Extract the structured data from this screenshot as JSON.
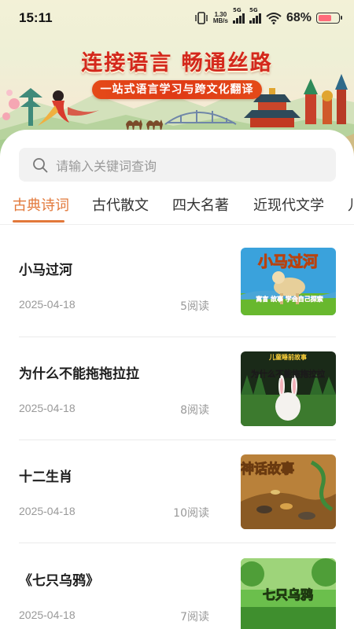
{
  "status_bar": {
    "time": "15:11",
    "net_speed_value": "1.30",
    "net_speed_unit": "MB/s",
    "signal_1_tag": "5G",
    "signal_2_tag": "5G",
    "battery_text": "68%",
    "battery_level": 0.68
  },
  "banner": {
    "title": "连接语言 畅通丝路",
    "subtitle": "一站式语言学习与跨文化翻译"
  },
  "search": {
    "placeholder": "请输入关键词查询"
  },
  "tabs": [
    {
      "label": "古典诗词",
      "active": true
    },
    {
      "label": "古代散文",
      "active": false
    },
    {
      "label": "四大名著",
      "active": false
    },
    {
      "label": "近现代文学",
      "active": false
    },
    {
      "label": "儿",
      "active": false
    }
  ],
  "articles": [
    {
      "title": "小马过河",
      "date": "2025-04-18",
      "reads": "5阅读",
      "thumb": {
        "headline": "小马过河",
        "caption": "寓言 故事  学会自己探索",
        "bg": "#3aa2dc",
        "ground": "#68b82e"
      }
    },
    {
      "title": "为什么不能拖拖拉拉",
      "date": "2025-04-18",
      "reads": "8阅读",
      "thumb": {
        "headline": "为什么不能拖拖拉拉",
        "caption": "儿童睡前故事",
        "bg": "#1a2a18",
        "ground": "#3c7a2e"
      }
    },
    {
      "title": "十二生肖",
      "date": "2025-04-18",
      "reads": "10阅读",
      "thumb": {
        "headline": "神话故事",
        "caption": "",
        "bg": "#b9813a",
        "ground": "#8a5a24"
      }
    },
    {
      "title": "《七只乌鸦》",
      "date": "2025-04-18",
      "reads": "7阅读",
      "thumb": {
        "headline": "七只乌鸦",
        "caption": "",
        "bg": "#6bbf4c",
        "ground": "#3f8f2e"
      }
    }
  ]
}
